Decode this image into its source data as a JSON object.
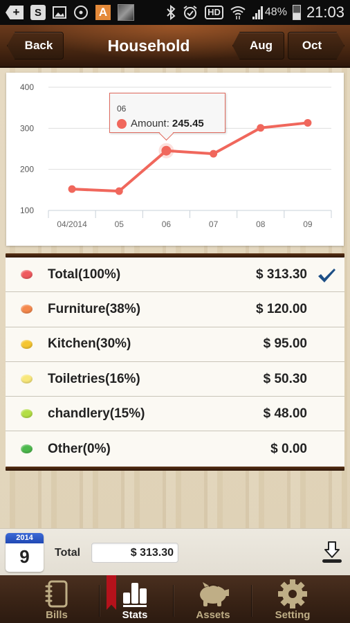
{
  "status_bar": {
    "left_icons": [
      "add-icon",
      "s-app-icon",
      "gallery-icon",
      "circle-app-icon",
      "a-app-icon",
      "contact-photo-icon"
    ],
    "right_icons": [
      "bluetooth-icon",
      "alarm-icon",
      "hd-icon",
      "wifi-icon",
      "signal-icon"
    ],
    "hd_label": "HD",
    "battery": "48%",
    "time": "21:03"
  },
  "header": {
    "back_label": "Back",
    "title": "Household",
    "prev_label": "Aug",
    "next_label": "Oct"
  },
  "tooltip": {
    "header": "06",
    "label": "Amount:",
    "value": "245.45"
  },
  "chart_data": {
    "type": "line",
    "title": "",
    "xlabel": "",
    "ylabel": "",
    "categories": [
      "04/2014",
      "05",
      "06",
      "07",
      "08",
      "09"
    ],
    "series": [
      {
        "name": "Amount",
        "values": [
          152,
          147,
          245.45,
          238,
          301,
          313.3
        ],
        "color": "#f0675c"
      }
    ],
    "yticks": [
      100,
      200,
      300,
      400
    ],
    "ylim": [
      100,
      400
    ],
    "grid": true,
    "highlighted_index": 2
  },
  "categories": [
    {
      "label": "Total(100%)",
      "amount": "$ 313.30",
      "color": "#ef5a5e",
      "selected": true
    },
    {
      "label": "Furniture(38%)",
      "amount": "$ 120.00",
      "color": "#f4884c",
      "selected": false
    },
    {
      "label": "Kitchen(30%)",
      "amount": "$ 95.00",
      "color": "#f5c530",
      "selected": false
    },
    {
      "label": "Toiletries(16%)",
      "amount": "$ 50.30",
      "color": "#f8e77a",
      "selected": false
    },
    {
      "label": "chandlery(15%)",
      "amount": "$ 48.00",
      "color": "#b3de45",
      "selected": false
    },
    {
      "label": "Other(0%)",
      "amount": "$ 0.00",
      "color": "#4cb84c",
      "selected": false
    }
  ],
  "summary": {
    "year": "2014",
    "month": "9",
    "total_label": "Total",
    "total_value": "$ 313.30"
  },
  "tabs": [
    {
      "label": "Bills",
      "icon": "notebook-icon",
      "active": false
    },
    {
      "label": "Stats",
      "icon": "bar-chart-icon",
      "active": true
    },
    {
      "label": "Assets",
      "icon": "piggy-bank-icon",
      "active": false
    },
    {
      "label": "Setting",
      "icon": "gear-icon",
      "active": false
    }
  ],
  "colors": {
    "accent": "#f0675c",
    "check": "#1d4f86",
    "active_ribbon": "#b5121b"
  }
}
